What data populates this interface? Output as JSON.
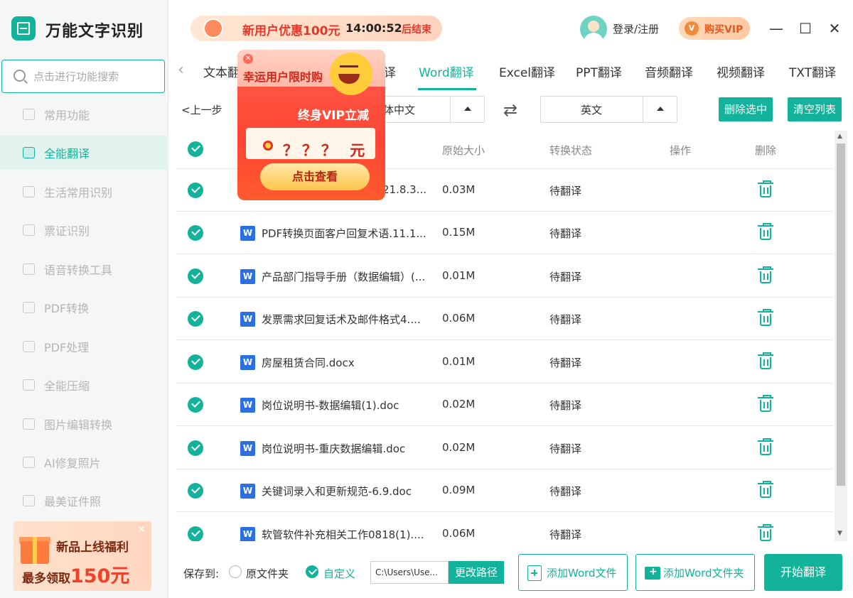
{
  "app": {
    "title": "万能文字识别"
  },
  "search": {
    "placeholder": "点击进行功能搜索"
  },
  "sidebar": {
    "items": [
      {
        "label": "常用功能",
        "icon": "star-icon"
      },
      {
        "label": "全能翻译",
        "icon": "translate-icon",
        "active": true
      },
      {
        "label": "生活常用识别",
        "icon": "scan-icon"
      },
      {
        "label": "票证识别",
        "icon": "ticket-icon"
      },
      {
        "label": "语音转换工具",
        "icon": "voice-icon"
      },
      {
        "label": "PDF转换",
        "icon": "pdf-convert-icon"
      },
      {
        "label": "PDF处理",
        "icon": "pdf-process-icon"
      },
      {
        "label": "全能压缩",
        "icon": "compress-icon"
      },
      {
        "label": "图片编辑转换",
        "icon": "image-edit-icon"
      },
      {
        "label": "AI修复照片",
        "icon": "ai-photo-icon"
      },
      {
        "label": "最美证件照",
        "icon": "id-photo-icon"
      }
    ],
    "promo": {
      "line1": "新品上线福利",
      "line2_prefix": "最多领取",
      "line2_amount": "150元"
    }
  },
  "titlebar": {
    "countdown": {
      "offer": "新用户优惠100元",
      "timer": "14:00:52",
      "suffix": "后结束"
    },
    "login": "登录/注册",
    "vip": "购买VIP",
    "minimize": "—",
    "maximize": "☐",
    "close": "✕"
  },
  "tabs": [
    {
      "label": "文本翻",
      "key": "text"
    },
    {
      "label": "译",
      "key": "hidden"
    },
    {
      "label": "Word翻译",
      "key": "word",
      "active": true
    },
    {
      "label": "Excel翻译",
      "key": "excel"
    },
    {
      "label": "PPT翻译",
      "key": "ppt"
    },
    {
      "label": "音频翻译",
      "key": "audio"
    },
    {
      "label": "视频翻译",
      "key": "video"
    },
    {
      "label": "TXT翻译",
      "key": "txt"
    }
  ],
  "toolbar": {
    "back": "<上一步",
    "source_lang": "体中文",
    "target_lang": "英文",
    "delete_selected": "删除选中",
    "clear_list": "清空列表"
  },
  "table": {
    "headers": {
      "size": "原始大小",
      "status": "转换状态",
      "action": "操作",
      "delete": "删除"
    },
    "rows": [
      {
        "name": "21.8.3...",
        "size": "0.03M",
        "status": "待翻译"
      },
      {
        "name": "PDF转换页面客户回复术语.11.1...",
        "size": "0.15M",
        "status": "待翻译"
      },
      {
        "name": "产品部门指导手册（数据编辑）(...",
        "size": "0.01M",
        "status": "待翻译"
      },
      {
        "name": "发票需求回复话术及邮件格式4....",
        "size": "0.06M",
        "status": "待翻译"
      },
      {
        "name": "房屋租赁合同.docx",
        "size": "0.01M",
        "status": "待翻译"
      },
      {
        "name": "岗位说明书-数据编辑(1).doc",
        "size": "0.02M",
        "status": "待翻译"
      },
      {
        "name": "岗位说明书-重庆数据编辑.doc",
        "size": "0.02M",
        "status": "待翻译"
      },
      {
        "name": "关键词录入和更新规范-6.9.doc",
        "size": "0.09M",
        "status": "待翻译"
      },
      {
        "name": "软管软件补充相关工作0818(1)....",
        "size": "0.06M",
        "status": "待翻译"
      }
    ]
  },
  "popup": {
    "title": "幸运用户限时购",
    "subtitle": "终身VIP立减",
    "amount": "？？？ 元",
    "button": "点击查看",
    "close": "✕"
  },
  "bottom": {
    "save_to": "保存到:",
    "option_original": "原文件夹",
    "option_custom": "自定义",
    "path": "C:\\Users\\Use...",
    "change_path": "更改路径",
    "add_file": "添加Word文件",
    "add_folder": "添加Word文件夹",
    "start": "开始翻译"
  },
  "colors": {
    "accent": "#12b39a",
    "promo_red": "#e5382a",
    "word_blue": "#2b6fe0"
  }
}
